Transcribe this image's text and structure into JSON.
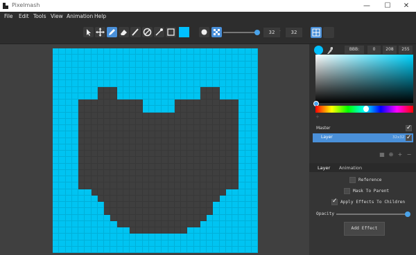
{
  "window": {
    "title": "Pixelmash",
    "minimize": "—",
    "maximize": "☐",
    "close": "✕"
  },
  "menu": [
    "File",
    "Edit",
    "Tools",
    "View",
    "Animation",
    "Help"
  ],
  "toolbar": {
    "brush_color": "#00c0ff",
    "brush_size_a": "32",
    "brush_size_b": "32",
    "brush_size_level": 0.9
  },
  "canvas": {
    "width_cells": 32,
    "height_cells": 32,
    "background_color": "#00c4f2",
    "fill_color": "#3f3f3f",
    "heart_rows": [
      [],
      [],
      [],
      [],
      [],
      [],
      [
        7,
        8,
        9,
        23,
        24,
        25
      ],
      [
        7,
        8,
        9,
        23,
        24,
        25
      ],
      [
        3,
        4,
        5,
        6,
        7,
        8,
        9,
        10,
        11,
        12,
        13,
        19,
        20,
        21,
        22,
        23,
        24,
        25,
        26,
        27,
        28
      ],
      [
        3,
        4,
        5,
        6,
        7,
        8,
        9,
        10,
        11,
        12,
        13,
        19,
        20,
        21,
        22,
        23,
        24,
        25,
        26,
        27,
        28
      ]
    ]
  },
  "color_picker": {
    "hex": "BBB:",
    "r": "0",
    "g": "208",
    "b": "255",
    "hue_level": 0.52
  },
  "layers": {
    "master_label": "Master",
    "layer_label": "Layer",
    "layer_size": "32x32"
  },
  "tabs": {
    "layer": "Layer",
    "animation": "Animation"
  },
  "properties": {
    "reference": "Reference",
    "mask_to_parent": "Mask To Parent",
    "apply_effects": "Apply Effects To Children",
    "opacity": "Opacity",
    "opacity_level": 1.0,
    "add_effect": "Add Effect"
  }
}
